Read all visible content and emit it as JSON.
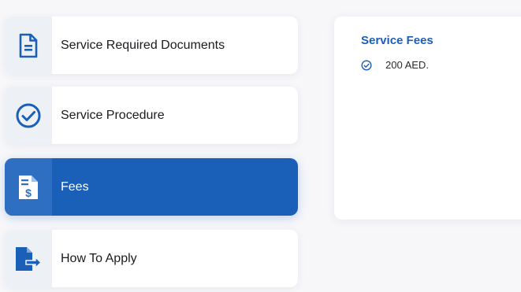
{
  "tabs": [
    {
      "label": "Service Required Documents",
      "icon": "document-icon"
    },
    {
      "label": "Service Procedure",
      "icon": "check-circle-icon"
    },
    {
      "label": "Fees",
      "icon": "fee-document-icon",
      "active": true
    },
    {
      "label": "How To Apply",
      "icon": "apply-arrow-icon"
    }
  ],
  "panel": {
    "title": "Service Fees",
    "fees": [
      {
        "text": "200 AED."
      }
    ]
  },
  "colors": {
    "accent": "#1a5fb8",
    "background": "#f7f7fa",
    "icon_box": "#edf0f5"
  }
}
